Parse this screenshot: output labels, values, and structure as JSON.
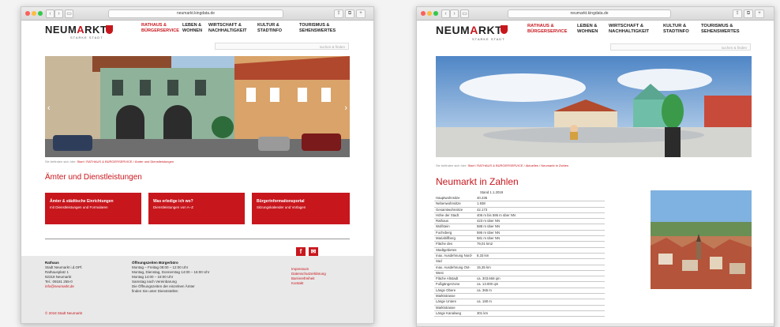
{
  "left_window": {
    "url": "neumarkt.kingdata.de",
    "logo": {
      "prefix": "NEUM",
      "accent": "A",
      "suffix": "RKT",
      "tagline": "STARKE STADT"
    },
    "menu": [
      {
        "line1": "RATHAUS &",
        "line2": "BÜRGERSERVICE",
        "active": true
      },
      {
        "line1": "LEBEN &",
        "line2": "WOHNEN"
      },
      {
        "line1": "WIRTSCHAFT &",
        "line2": "NACHHALTIGKEIT"
      },
      {
        "line1": "KULTUR &",
        "line2": "STADTINFO"
      },
      {
        "line1": "TOURISMUS &",
        "line2": "SEHENSWERTES"
      }
    ],
    "search_placeholder": "suchen & finden",
    "breadcrumb": {
      "lead": "Sie befinden sich hier:",
      "path": "Start / RATHAUS & BÜRGERSERVICE / Ämter und Dienstleistungen"
    },
    "heading": "Ämter und Dienstleistungen",
    "tiles": [
      {
        "title": "Ämter & städtische Einrichtungen",
        "text": "mit Dienstleistungen und Formularen"
      },
      {
        "title": "Was erledige ich wo?",
        "text": "Dienstleistungen von A–Z"
      },
      {
        "title": "Bürgerinformationsportal",
        "text": "Sitzungskalender und Vorlagen"
      }
    ],
    "footer": {
      "col1_title": "Rathaus",
      "col1_lines": [
        "Stadt Neumarkt i.d.OPf.",
        "Rathausplatz 1",
        "92318 Neumarkt",
        "Tel.: 09181 255-0",
        "info@neumarkt.de"
      ],
      "col2_title": "Öffnungszeiten Bürgerbüro",
      "col2_lines": [
        "Montag – Freitag 08:00 – 12:00 Uhr",
        "Montag, Dienstag, Donnerstag 14:00 – 16:00 Uhr",
        "Montag 14:00 – 18:00 Uhr",
        "Samstag nach Vereinbarung",
        "Die Öffnungszeiten der einzelnen Ämter",
        "finden Sie unter Dienststellen"
      ],
      "col3_lines": [
        "Impressum",
        "Datenschutzerklärung",
        "Barrierefreiheit",
        "Kontakt"
      ],
      "copyright": "© 2018 Stadt Neumarkt"
    },
    "social": [
      "f",
      "✉"
    ]
  },
  "right_window": {
    "url": "neumarkt.kingdata.de",
    "logo": {
      "prefix": "NEUM",
      "accent": "A",
      "suffix": "RKT",
      "tagline": "STARKE STADT"
    },
    "menu": [
      {
        "line1": "RATHAUS &",
        "line2": "BÜRGERSERVICE",
        "active": true
      },
      {
        "line1": "LEBEN &",
        "line2": "WOHNEN"
      },
      {
        "line1": "WIRTSCHAFT &",
        "line2": "NACHHALTIGKEIT"
      },
      {
        "line1": "KULTUR &",
        "line2": "STADTINFO"
      },
      {
        "line1": "TOURISMUS &",
        "line2": "SEHENSWERTES"
      }
    ],
    "search_placeholder": "suchen & finden",
    "breadcrumb": {
      "lead": "Sie befinden sich hier:",
      "path": "Start / RATHAUS & BÜRGERSERVICE / Aktuelles / Neumarkt in Zahlen"
    },
    "heading": "Neumarkt in Zahlen",
    "table_header": "Stand 1.1.2019",
    "rows": [
      [
        "Hauptwohnsitze",
        "40.235"
      ],
      [
        "Nebenwohnsitze",
        "1.938"
      ],
      [
        "Gesamtwohnsitze",
        "42.173"
      ],
      [
        "Höhe der Stadt",
        "406 m bis 595 m über NN"
      ],
      [
        "Rathaus",
        "423 m über NN"
      ],
      [
        "Wolfstein",
        "588 m über NN"
      ],
      [
        "Fuchsberg",
        "595 m über NN"
      ],
      [
        "Mariahilfberg",
        "581 m über NN"
      ],
      [
        "Fläche des",
        "79,01 km2"
      ],
      [
        "Stadtgebietes",
        ""
      ],
      [
        "max. Ausdehnung Nord-",
        "8,33 km"
      ],
      [
        "Süd",
        ""
      ],
      [
        "max. Ausdehnung Ost-",
        "15,35 km"
      ],
      [
        "West",
        ""
      ],
      [
        "Fläche Altstadt",
        "ca. 303.668 qm"
      ],
      [
        "Fußgängerzone",
        "ca. 13.000 qm"
      ],
      [
        "Länge Obere",
        "ca. 365 m"
      ],
      [
        "Marktstrasse",
        ""
      ],
      [
        "Länge Untere",
        "ca. 180 m"
      ],
      [
        "Marktstrasse",
        ""
      ],
      [
        "Länge Kanalweg",
        "301 km"
      ]
    ]
  }
}
